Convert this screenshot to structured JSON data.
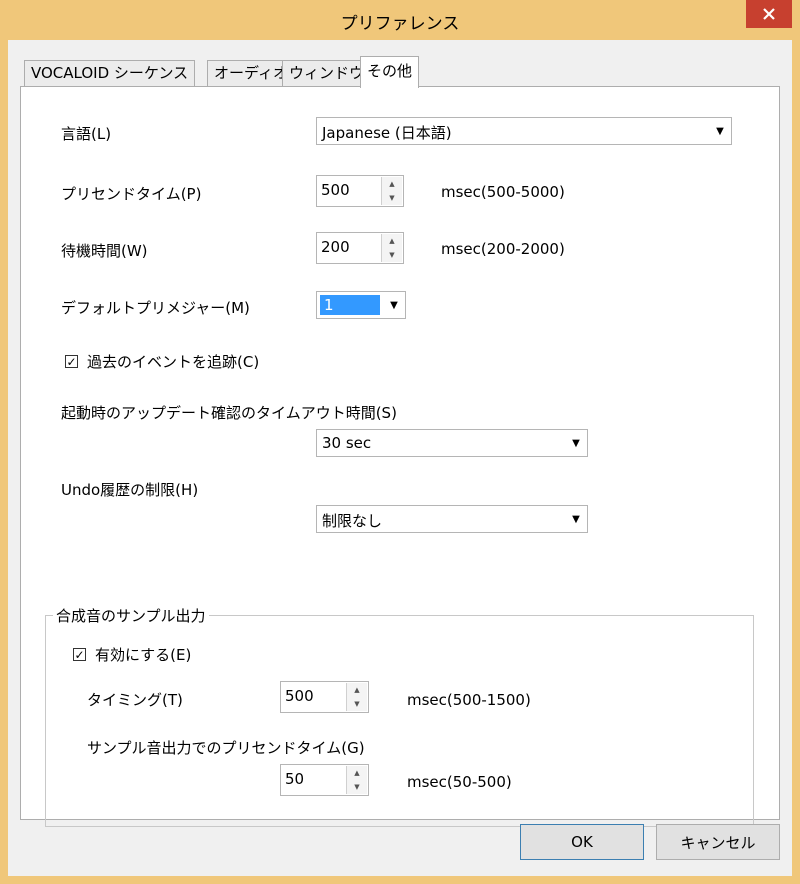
{
  "window": {
    "title": "プリファレンス"
  },
  "tabs": [
    "VOCALOID シーケンス",
    "オーディオ",
    "ウィンドウ",
    "その他"
  ],
  "language": {
    "label": "言語(L)",
    "value": "Japanese (日本語)"
  },
  "presend": {
    "label": "プリセンドタイム(P)",
    "value": "500",
    "range": "msec(500-5000)"
  },
  "wait": {
    "label": "待機時間(W)",
    "value": "200",
    "range": "msec(200-2000)"
  },
  "premeasure": {
    "label": "デフォルトプリメジャー(M)",
    "value": "1"
  },
  "track_events": {
    "label": "過去のイベントを追跡(C)",
    "checked": true
  },
  "update_timeout": {
    "label": "起動時のアップデート確認のタイムアウト時間(S)",
    "value": "30 sec"
  },
  "undo_limit": {
    "label": "Undo履歴の制限(H)",
    "value": "制限なし"
  },
  "sample_output": {
    "group_title": "合成音のサンプル出力",
    "enable": {
      "label": "有効にする(E)",
      "checked": true
    },
    "timing": {
      "label": "タイミング(T)",
      "value": "500",
      "range": "msec(500-1500)"
    },
    "presend": {
      "label": "サンプル音出力でのプリセンドタイム(G)",
      "value": "50",
      "range": "msec(50-500)"
    }
  },
  "buttons": {
    "ok": "OK",
    "cancel": "キャンセル"
  },
  "colors": {
    "frame": "#f0c77a",
    "close": "#c7402f",
    "selection": "#3399ff"
  }
}
